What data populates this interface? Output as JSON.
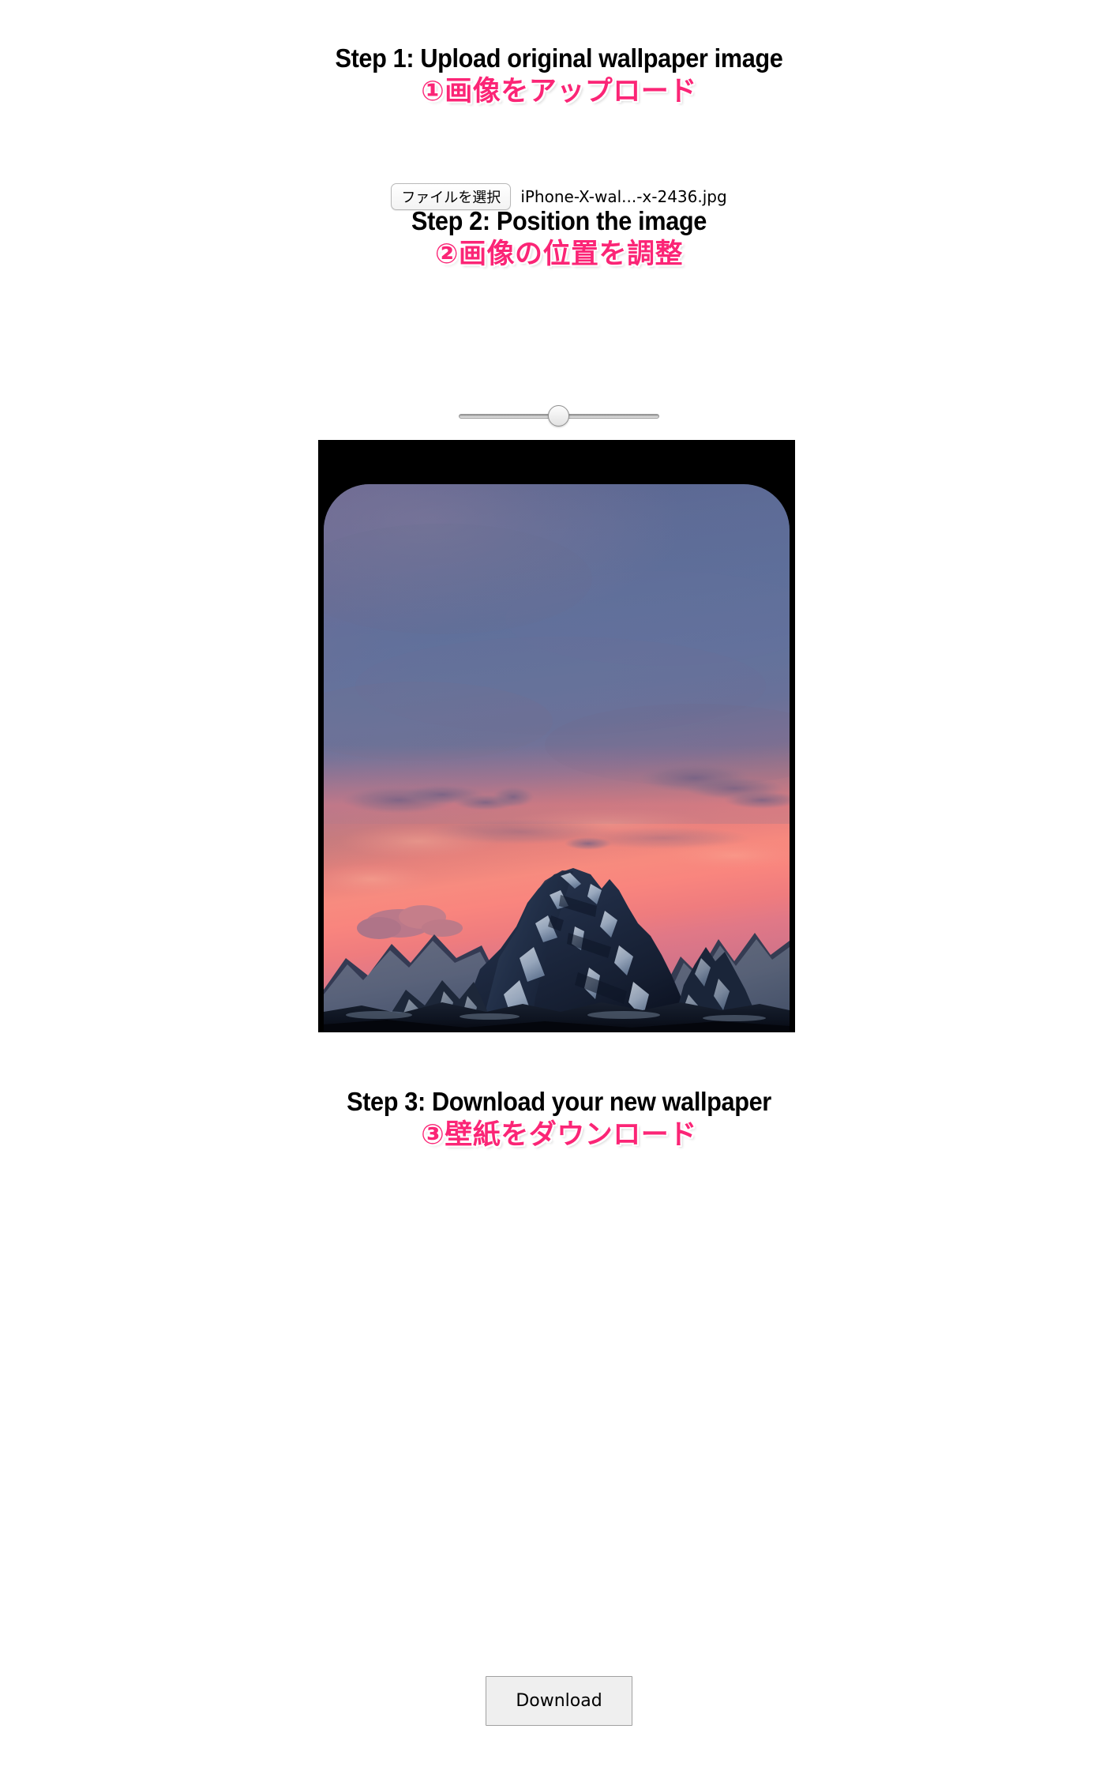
{
  "steps": {
    "step1": {
      "title_en": "Step 1: Upload original wallpaper image",
      "title_jp": "①画像をアップロード"
    },
    "step2": {
      "title_en": "Step 2: Position the image",
      "title_jp": "②画像の位置を調整"
    },
    "step3": {
      "title_en": "Step 3: Download your new wallpaper",
      "title_jp": "③壁紙をダウンロード"
    }
  },
  "file_input": {
    "button_label": "ファイルを選択",
    "file_name": "iPhone-X-wal...-x-2436.jpg"
  },
  "position_slider": {
    "value": "50",
    "min": "0",
    "max": "100"
  },
  "download": {
    "button_label": "Download"
  },
  "colors": {
    "accent_pink": "#FB2576",
    "heading_black": "#000000",
    "frame_black": "#000000",
    "page_background": "#FFFFFF",
    "sky_upper": "#5A6A93",
    "sky_glow": "#F4878A",
    "sunset_coral": "#F98279",
    "mountain_dark": "#1B2438",
    "snow_light": "#C5D3E4"
  }
}
